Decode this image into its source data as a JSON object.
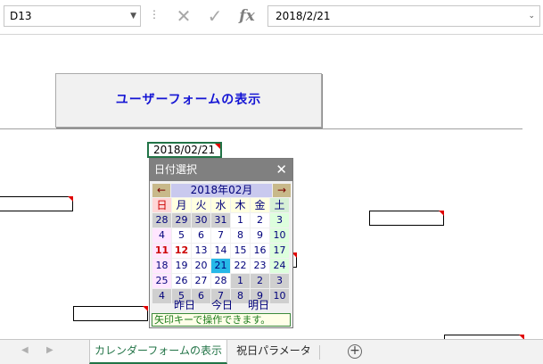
{
  "formula_bar": {
    "name_box": "D13",
    "separator": "⋮",
    "cancel_icon": "close-icon",
    "enter_icon": "check-icon",
    "function_label": "fx",
    "formula_value": "2018/2/21"
  },
  "sheet": {
    "show_form_button": "ユーザーフォームの表示",
    "date_cell": "2018/02/21"
  },
  "form": {
    "title": "日付選択",
    "close": "✕",
    "prev": "←",
    "next": "→",
    "month": "2018年02月",
    "weekdays": [
      "日",
      "月",
      "火",
      "水",
      "木",
      "金",
      "土"
    ],
    "weeks": [
      [
        "28",
        "29",
        "30",
        "31",
        "1",
        "2",
        "3"
      ],
      [
        "4",
        "5",
        "6",
        "7",
        "8",
        "9",
        "10"
      ],
      [
        "11",
        "12",
        "13",
        "14",
        "15",
        "16",
        "17"
      ],
      [
        "18",
        "19",
        "20",
        "21",
        "22",
        "23",
        "24"
      ],
      [
        "25",
        "26",
        "27",
        "28",
        "1",
        "2",
        "3"
      ],
      [
        "4",
        "5",
        "6",
        "7",
        "8",
        "9",
        "10"
      ]
    ],
    "selected_day": "21",
    "holidays": [
      "11",
      "12"
    ],
    "yesterday": "昨日",
    "today": "今日",
    "tomorrow": "明日",
    "status": "矢印キーで操作できます。"
  },
  "tabs": {
    "active": "カレンダーフォームの表示",
    "second": "祝日パラメータ",
    "add": "+"
  },
  "colors": {
    "excel_green": "#217346",
    "accent_blue": "#1414d4",
    "selected_day": "#26b8e8"
  }
}
